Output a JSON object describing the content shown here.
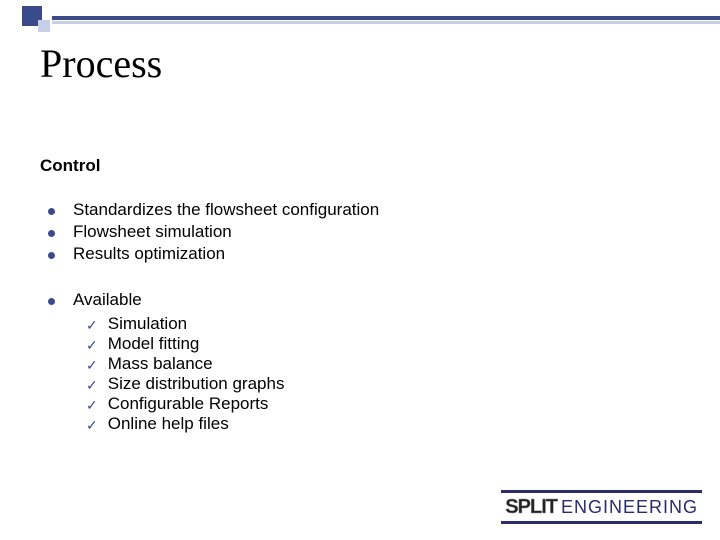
{
  "title": "Process",
  "section": "Control",
  "bullets_a": [
    "Standardizes the flowsheet configuration",
    "Flowsheet simulation",
    "Results optimization"
  ],
  "bullet_b_head": "Available",
  "sub_items": [
    "Simulation",
    "Model fitting",
    "Mass balance",
    "Size distribution graphs",
    "Configurable Reports",
    "Online help files"
  ],
  "logo": {
    "part1": "SPLIT",
    "part2": "ENGINEERING"
  }
}
